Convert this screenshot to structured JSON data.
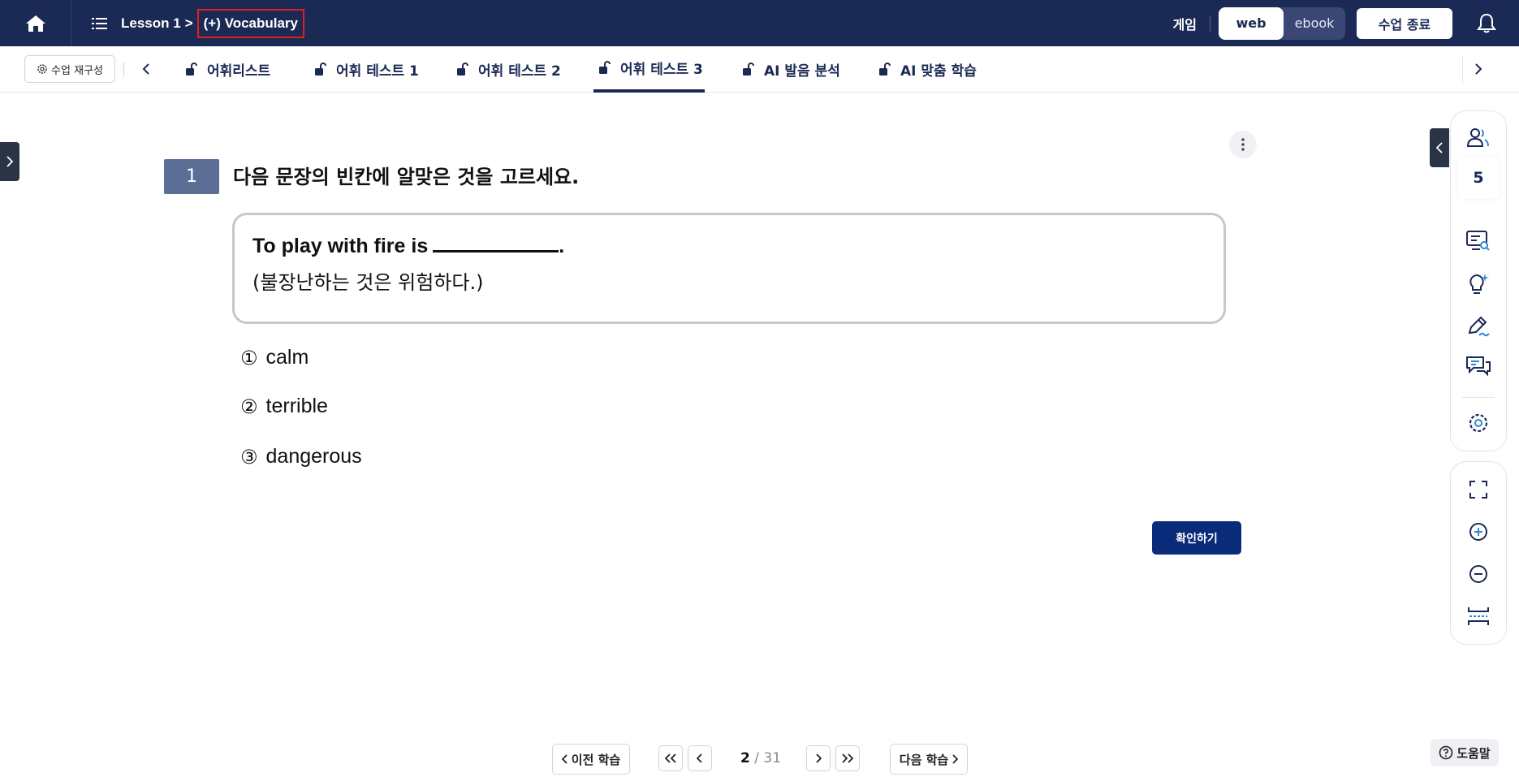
{
  "topbar": {
    "lesson": "Lesson 1",
    "separator": ">",
    "current": "(+) Vocabulary",
    "game_label": "게임",
    "view_web": "web",
    "view_ebook": "ebook",
    "end_class": "수업 종료"
  },
  "tabs": {
    "reorganize": "수업 재구성",
    "items": [
      {
        "label": "어휘리스트"
      },
      {
        "label": "어휘 테스트 1"
      },
      {
        "label": "어휘 테스트 2"
      },
      {
        "label": "어휘 테스트 3"
      },
      {
        "label": "AI 발음 분석"
      },
      {
        "label": "AI 맞춤 학습"
      }
    ]
  },
  "question": {
    "number": "1",
    "instruction": "다음 문장의 빈칸에 알맞은 것을 고르세요.",
    "sentence": "To play with fire is",
    "sentence_end": ".",
    "translation": "(불장난하는 것은 위험하다.)",
    "options": [
      {
        "num": "①",
        "text": "calm"
      },
      {
        "num": "②",
        "text": "terrible"
      },
      {
        "num": "③",
        "text": "dangerous"
      }
    ],
    "confirm": "확인하기"
  },
  "sidebar": {
    "participants_count": "5"
  },
  "pager": {
    "prev_label": "이전 학습",
    "next_label": "다음 학습",
    "current": "2",
    "total": "/ 31"
  },
  "help": {
    "label": "도움말"
  },
  "colors": {
    "navy": "#1b2a55",
    "confirm_blue": "#0a2a7a",
    "highlight_red": "#e02020"
  }
}
